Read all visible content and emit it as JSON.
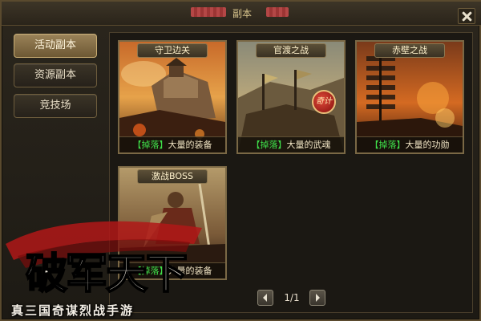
{
  "window": {
    "title": "副本",
    "close_icon": "close-icon"
  },
  "sidebar": {
    "items": [
      {
        "label": "活动副本",
        "active": true
      },
      {
        "label": "资源副本",
        "active": false
      },
      {
        "label": "竞技场",
        "active": false
      }
    ]
  },
  "cards": [
    {
      "title": "守卫边关",
      "drop_tag": "【掉落】",
      "reward": "大量的装备"
    },
    {
      "title": "官渡之战",
      "drop_tag": "【掉落】",
      "reward": "大量的武魂",
      "seal_text": "奇计"
    },
    {
      "title": "赤壁之战",
      "drop_tag": "【掉落】",
      "reward": "大量的功勋"
    },
    {
      "title": "激战BOSS",
      "drop_tag": "【掉落】",
      "reward": "大量的装备"
    }
  ],
  "pager": {
    "text": "1/1",
    "prev_icon": "chevron-left-icon",
    "next_icon": "chevron-right-icon"
  },
  "watermark": {
    "logo_text": "破军天下",
    "slogan": "真三国奇谋烈战手游"
  },
  "colors": {
    "drop_tag": "#3fe04a",
    "active_tab": "#9a8258",
    "frame_border": "#7a6845"
  }
}
